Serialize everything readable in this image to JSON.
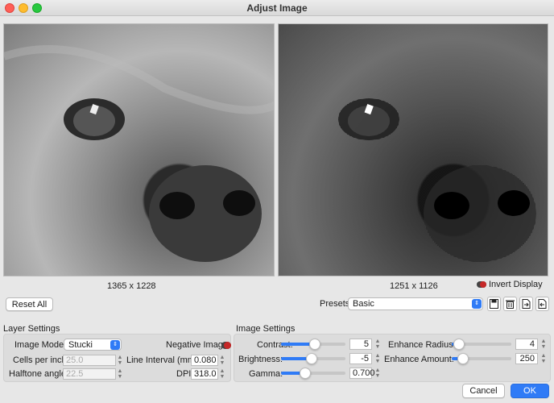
{
  "window": {
    "title": "Adjust Image"
  },
  "images": {
    "left_dimensions": "1365 x 1228",
    "right_dimensions": "1251 x 1126"
  },
  "invert_display": {
    "label": "Invert Display",
    "on": false
  },
  "toolbar": {
    "reset_label": "Reset All",
    "presets_label": "Presets",
    "preset_value": "Basic"
  },
  "layer_settings": {
    "title": "Layer Settings",
    "image_mode_label": "Image Mode:",
    "image_mode_value": "Stucki",
    "negative_image_label": "Negative Image",
    "cells_per_inch_label": "Cells per inch",
    "cells_per_inch_value": "25.0",
    "line_interval_label": "Line Interval (mm)",
    "line_interval_value": "0.080",
    "halftone_angle_label": "Halftone angle",
    "halftone_angle_value": "22.5",
    "dpi_label": "DPI",
    "dpi_value": "318.0"
  },
  "image_settings": {
    "title": "Image Settings",
    "contrast_label": "Contrast:",
    "contrast_value": "5",
    "brightness_label": "Brightness:",
    "brightness_value": "-5",
    "gamma_label": "Gamma:",
    "gamma_value": "0.700",
    "enhance_radius_label": "Enhance Radius:",
    "enhance_radius_value": "4",
    "enhance_amount_label": "Enhance Amount:",
    "enhance_amount_value": "250"
  },
  "dialog": {
    "cancel_label": "Cancel",
    "ok_label": "OK"
  }
}
